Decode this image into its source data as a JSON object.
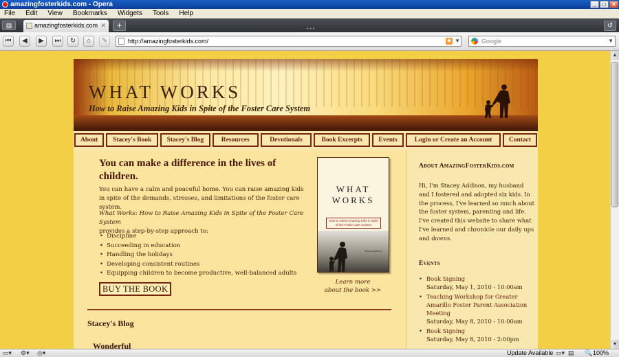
{
  "browser": {
    "window_title": "amazingfosterkids.com - Opera",
    "menu": [
      "File",
      "Edit",
      "View",
      "Bookmarks",
      "Widgets",
      "Tools",
      "Help"
    ],
    "tab_title": "amazingfosterkids.com",
    "url": "http://amazingfosterkids.com/",
    "search_placeholder": "Google",
    "status_update": "Update Available",
    "zoom": "100%"
  },
  "site": {
    "title": "WHAT WORKS",
    "tagline": "How to Raise Amazing Kids in Spite of the Foster Care System",
    "nav": [
      "About",
      "Stacey's Book",
      "Stacey's Blog",
      "Resources",
      "Devotionals",
      "Book Excerpts",
      "Events",
      "Login or Create an Account",
      "Contact"
    ],
    "hero": {
      "heading": "You can make a difference in the lives of children.",
      "paragraph": "You can have a calm and peaceful home. You can raise amazing kids in spite of the demands, stresses, and limitations of the foster care system.",
      "book_title": "What Works: How to Raise Amazing Kids in Spite of the Foster Care System",
      "book_desc": "provides a step-by-step approach to:",
      "features": [
        "Discipline",
        "Succeeding in education",
        "Handling the holidays",
        "Developing consistent routines",
        "Equipping children to become productive, well-balanced adults"
      ],
      "buy_label": "BUY THE BOOK"
    },
    "book_cover": {
      "title_line1": "WHAT",
      "title_line2": "WORKS",
      "subtitle": "How to Raise Amazing Kids in Spite of the Foster Care System",
      "author": "Stacy Addison"
    },
    "learn_more": {
      "line1": "Learn more",
      "line2": "about the book >>"
    },
    "blog": {
      "heading": "Stacey's Blog",
      "post_title": "Wonderful"
    },
    "sidebar": {
      "about_heading": "About AmazingFosterKids.com",
      "about_text": "Hi, I'm Stacey Addison, my husband and I fostered and adopted six kids. In the process, I've learned so much about the foster system, parenting and life. I've created this website to share what I've learned and chronicle our daily ups and downs.",
      "events_heading": "Events",
      "events": [
        {
          "title": "Book Signing",
          "date": "Saturday, May 1, 2010 - 10:00am"
        },
        {
          "title": "Teaching Workshop for Greater Amarillo Foster Parent Association Meeting",
          "date": "Saturday, May 8, 2010 - 10:00am"
        },
        {
          "title": "Book Signing",
          "date": "Saturday, May 8, 2010 - 2:00pm"
        }
      ]
    }
  },
  "colors": {
    "page_background": "#f3cf45",
    "content_background": "#fbe59e",
    "accent": "#7a2414"
  }
}
